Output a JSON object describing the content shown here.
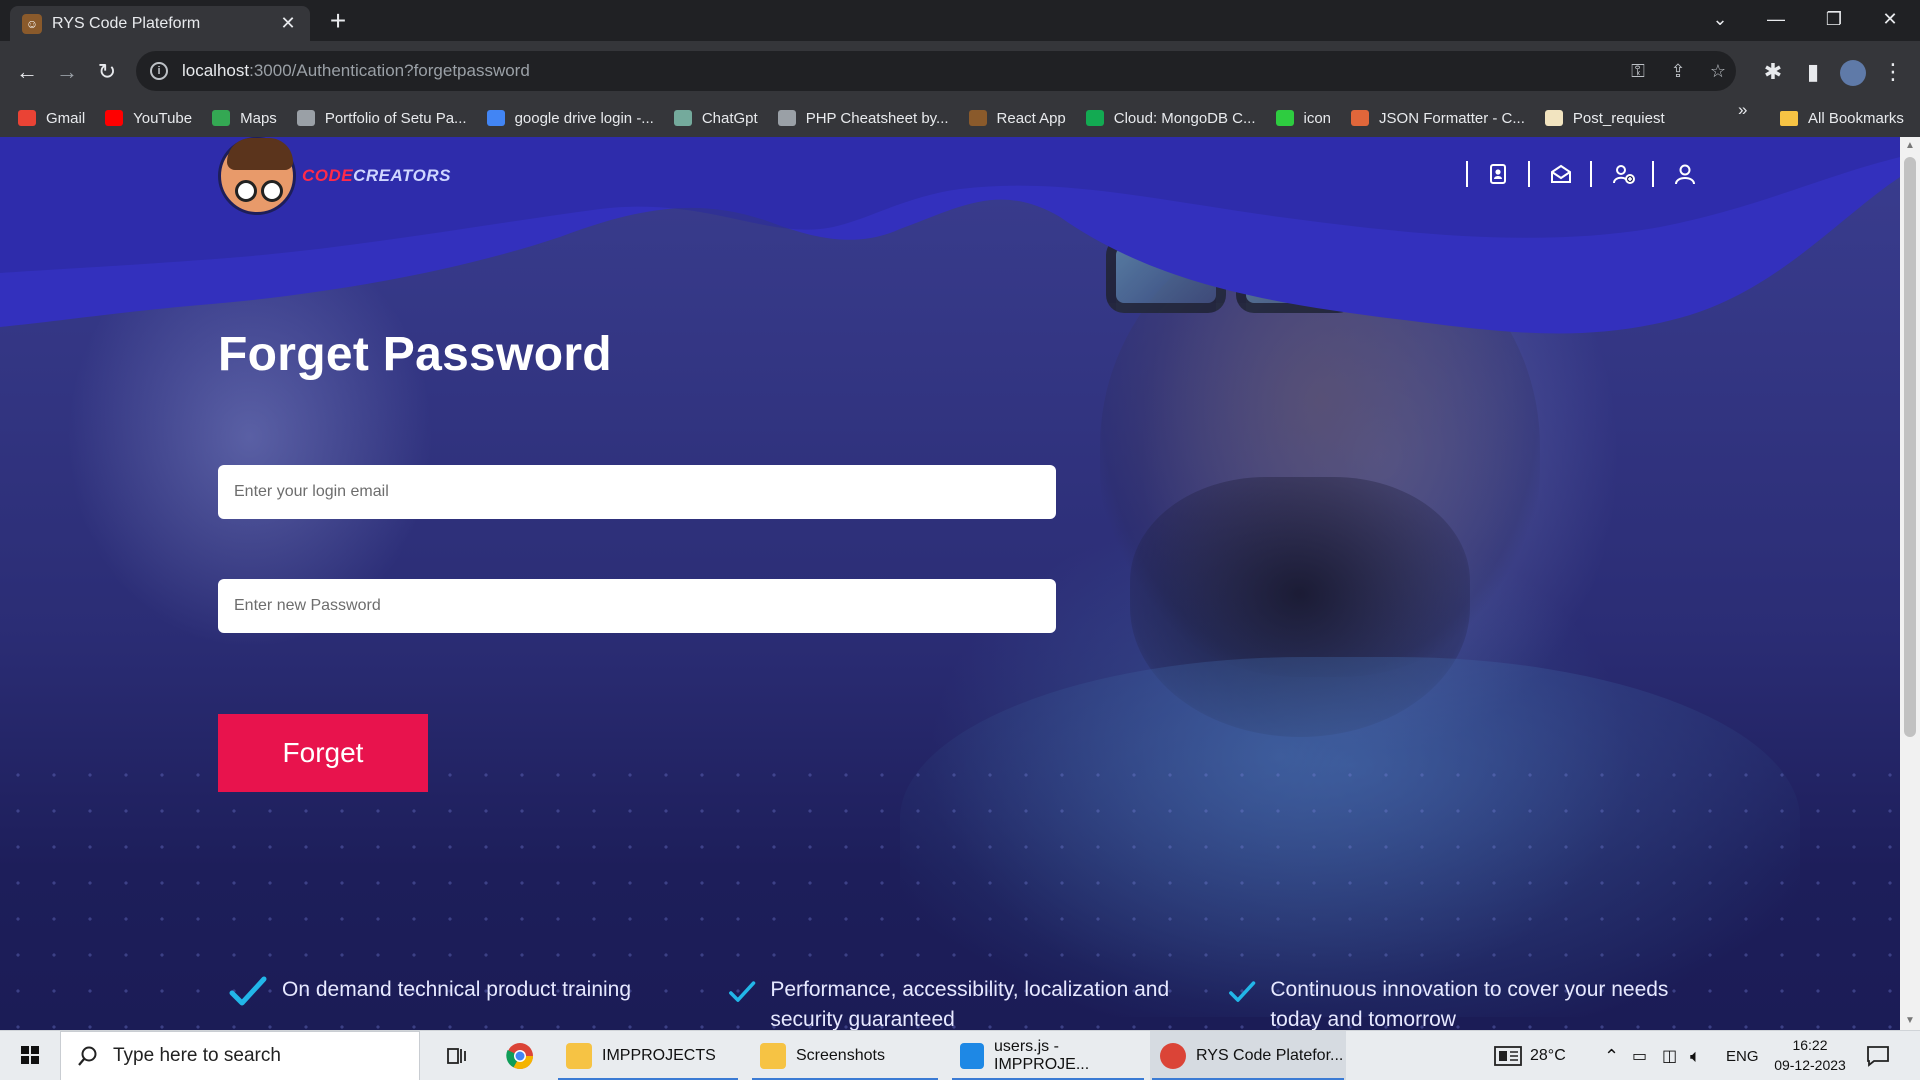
{
  "browser": {
    "tab_title": "RYS Code Plateform",
    "url_host": "localhost",
    "url_path": ":3000/Authentication?forgetpassword",
    "bookmarks": [
      {
        "label": "Gmail",
        "color": "#ea4335",
        "icon": "gmail-icon"
      },
      {
        "label": "YouTube",
        "color": "#ff0000",
        "icon": "youtube-icon"
      },
      {
        "label": "Maps",
        "color": "#34a853",
        "icon": "maps-icon"
      },
      {
        "label": "Portfolio of Setu Pa...",
        "color": "#9aa0a6",
        "icon": "globe-icon"
      },
      {
        "label": "google drive login -...",
        "color": "#4285f4",
        "icon": "google-icon"
      },
      {
        "label": "ChatGpt",
        "color": "#74aa9c",
        "icon": "chatgpt-icon"
      },
      {
        "label": "PHP Cheatsheet by...",
        "color": "#9aa0a6",
        "icon": "globe-icon"
      },
      {
        "label": "React App",
        "color": "#8a5a2b",
        "icon": "react-app-icon"
      },
      {
        "label": "Cloud: MongoDB C...",
        "color": "#13aa52",
        "icon": "mongodb-icon"
      },
      {
        "label": "icon",
        "color": "#2ecc40",
        "icon": "icon-bookmark-icon"
      },
      {
        "label": "JSON Formatter - C...",
        "color": "#e0663a",
        "icon": "json-icon"
      },
      {
        "label": "Post_requiest",
        "color": "#f2e4c0",
        "icon": "page-icon"
      }
    ],
    "all_bookmarks": "All Bookmarks"
  },
  "site": {
    "brand_part1": "CODE",
    "brand_part2": "CREATORS",
    "nav_icons": [
      "contact-card-icon",
      "mail-icon",
      "add-user-icon",
      "user-icon"
    ]
  },
  "form": {
    "title": "Forget Password",
    "email_placeholder": "Enter your login email",
    "password_placeholder": "Enter new Password",
    "submit_label": "Forget"
  },
  "features": [
    {
      "text": "On demand technical product training"
    },
    {
      "text": "Performance, accessibility, localization and security guaranteed"
    },
    {
      "text": "Continuous innovation to cover your needs today and tomorrow"
    }
  ],
  "taskbar": {
    "search_placeholder": "Type here to search",
    "apps": [
      {
        "label": "IMPPROJECTS"
      },
      {
        "label": "Screenshots"
      },
      {
        "label": "users.js - IMPPROJE..."
      },
      {
        "label": "RYS Code Platefor..."
      }
    ],
    "weather": "28°C",
    "language": "ENG",
    "time": "16:22",
    "date": "09-12-2023"
  },
  "colors": {
    "primary_navy": "#1d1e5a",
    "wave_blue": "#3a34c0",
    "accent_red": "#e8134d",
    "check_cyan": "#22b6e8"
  }
}
